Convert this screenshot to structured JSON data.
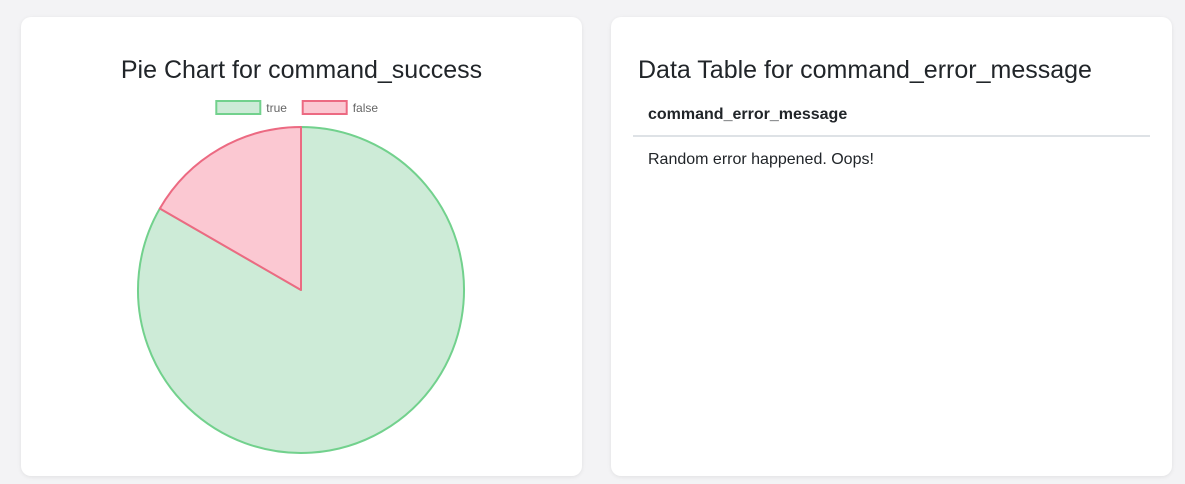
{
  "pie_card": {
    "title": "Pie Chart for command_success"
  },
  "table_card": {
    "title": "Data Table for command_error_message",
    "columns": [
      "command_error_message"
    ],
    "rows": [
      [
        "Random error happened. Oops!"
      ]
    ]
  },
  "chart_data": {
    "type": "pie",
    "title": "Pie Chart for command_success",
    "categories": [
      "true",
      "false"
    ],
    "values": [
      5,
      1
    ],
    "legend": "top",
    "colors": [
      {
        "fill": "#cdebd7",
        "stroke": "#72d18d"
      },
      {
        "fill": "#fbc8d2",
        "stroke": "#ec6a82"
      }
    ]
  }
}
